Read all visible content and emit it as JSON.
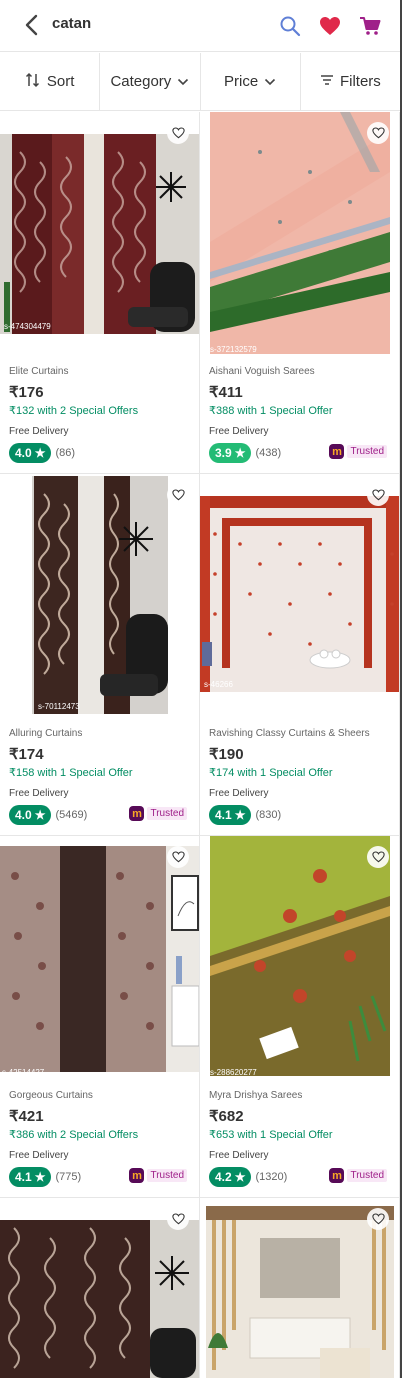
{
  "header": {
    "search_query": "catan",
    "icons": [
      "back-arrow-icon",
      "search-icon",
      "heart-icon",
      "cart-icon"
    ],
    "colors": {
      "search": "#5f7fd6",
      "heart": "#e0294a",
      "cart": "#9f2089"
    }
  },
  "filters": [
    {
      "label": "Sort",
      "icon": "sort-arrows-icon"
    },
    {
      "label": "Category",
      "icon": "chevron-down-icon"
    },
    {
      "label": "Price",
      "icon": "chevron-down-icon"
    },
    {
      "label": "Filters",
      "icon": "filter-lines-icon"
    }
  ],
  "products": [
    {
      "title": "Elite Curtains",
      "price": "₹176",
      "offer": "₹132 with 2 Special Offers",
      "delivery": "Free Delivery",
      "rating": "4.0",
      "count": "(86)",
      "trusted": "",
      "sku": "s-474304479"
    },
    {
      "title": "Aishani Voguish Sarees",
      "price": "₹411",
      "offer": "₹388 with 1 Special Offer",
      "delivery": "Free Delivery",
      "rating": "3.9",
      "count": "(438)",
      "trusted": "Trusted",
      "sku": "s-372132579"
    },
    {
      "title": "Alluring Curtains",
      "price": "₹174",
      "offer": "₹158 with 1 Special Offer",
      "delivery": "Free Delivery",
      "rating": "4.0",
      "count": "(5469)",
      "trusted": "Trusted",
      "sku": "s-70112473"
    },
    {
      "title": "Ravishing Classy Curtains & Sheers",
      "price": "₹190",
      "offer": "₹174 with 1 Special Offer",
      "delivery": "Free Delivery",
      "rating": "4.1",
      "count": "(830)",
      "trusted": "",
      "sku": "s-46266"
    },
    {
      "title": "Gorgeous Curtains",
      "price": "₹421",
      "offer": "₹386 with 2 Special Offers",
      "delivery": "Free Delivery",
      "rating": "4.1",
      "count": "(775)",
      "trusted": "Trusted",
      "sku": "s-42514427"
    },
    {
      "title": "Myra Drishya Sarees",
      "price": "₹682",
      "offer": "₹653 with 1 Special Offer",
      "delivery": "Free Delivery",
      "rating": "4.2",
      "count": "(1320)",
      "trusted": "Trusted",
      "sku": "s-288620277"
    },
    {
      "title": "",
      "price": "",
      "offer": "",
      "delivery": "",
      "rating": "",
      "count": "",
      "trusted": "",
      "sku": ""
    },
    {
      "title": "",
      "price": "",
      "offer": "",
      "delivery": "",
      "rating": "",
      "count": "",
      "trusted": "",
      "sku": ""
    }
  ],
  "trusted_badge_letter": "m",
  "colors": {
    "green": "#038d63",
    "green_light": "#23bb75",
    "brand": "#9f2089"
  }
}
